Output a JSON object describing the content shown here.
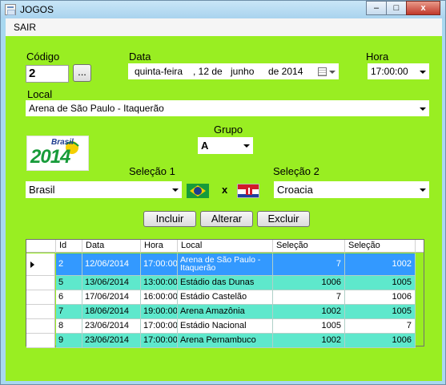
{
  "window": {
    "title": "JOGOS",
    "controls": {
      "minimize": "–",
      "maximize": "□",
      "close": "x"
    }
  },
  "menu": {
    "sair": "SAIR"
  },
  "form": {
    "codigo_label": "Código",
    "codigo_value": "2",
    "codigo_button": "...",
    "data_label": "Data",
    "data_weekday": "quinta-feira",
    "data_day": ", 12 de",
    "data_month": "junho",
    "data_year": "de 2014",
    "hora_label": "Hora",
    "hora_value": "17:00:00",
    "local_label": "Local",
    "local_value": "Arena de São Paulo - Itaquerão",
    "grupo_label": "Grupo",
    "grupo_value": "A",
    "selecao1_label": "Seleção 1",
    "selecao1_value": "Brasil",
    "vs": "x",
    "selecao2_label": "Seleção 2",
    "selecao2_value": "Croacia",
    "incluir": "Incluir",
    "alterar": "Alterar",
    "excluir": "Excluir"
  },
  "logo": {
    "line1": "Brasil",
    "line2": "2014"
  },
  "grid": {
    "columns": [
      "Id",
      "Data",
      "Hora",
      "Local",
      "Seleção",
      "Seleção"
    ],
    "rows": [
      {
        "id": "2",
        "data": "12/06/2014",
        "hora": "17:00:00",
        "local": "Arena de São Paulo - Itaquerão",
        "s1": "7",
        "s2": "1002",
        "style": "sel"
      },
      {
        "id": "5",
        "data": "13/06/2014",
        "hora": "13:00:00",
        "local": "Estádio das Dunas",
        "s1": "1006",
        "s2": "1005",
        "style": "teal"
      },
      {
        "id": "6",
        "data": "17/06/2014",
        "hora": "16:00:00",
        "local": "Estádio Castelão",
        "s1": "7",
        "s2": "1006",
        "style": "white"
      },
      {
        "id": "7",
        "data": "18/06/2014",
        "hora": "19:00:00",
        "local": "Arena Amazônia",
        "s1": "1002",
        "s2": "1005",
        "style": "teal"
      },
      {
        "id": "8",
        "data": "23/06/2014",
        "hora": "17:00:00",
        "local": "Estádio Nacional",
        "s1": "1005",
        "s2": "7",
        "style": "white"
      },
      {
        "id": "9",
        "data": "23/06/2014",
        "hora": "17:00:00",
        "local": "Arena Pernambuco",
        "s1": "1002",
        "s2": "1006",
        "style": "teal"
      }
    ]
  },
  "colors": {
    "form_bg": "#99ee22",
    "selected_row": "#3399ff",
    "alt_row": "#5ee8cc"
  }
}
